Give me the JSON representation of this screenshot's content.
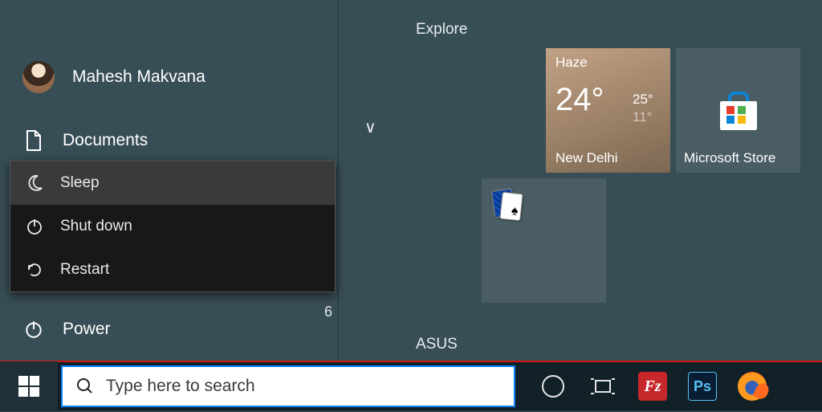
{
  "user": {
    "name": "Mahesh Makvana"
  },
  "sidebar": {
    "documents_label": "Documents",
    "power_label": "Power"
  },
  "power_menu": {
    "sleep": "Sleep",
    "shutdown": "Shut down",
    "restart": "Restart"
  },
  "stray": {
    "cutoff_digit": "6"
  },
  "groups": {
    "explore": "Explore",
    "asus": "ASUS"
  },
  "tiles": {
    "weather": {
      "condition": "Haze",
      "temp": "24°",
      "high": "25°",
      "low": "11°",
      "city": "New Delhi"
    },
    "store": {
      "label": "Microsoft Store"
    }
  },
  "search": {
    "placeholder": "Type here to search"
  }
}
